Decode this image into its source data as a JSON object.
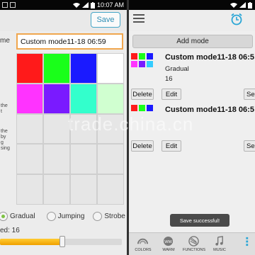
{
  "left_panel": {
    "status_bar": {
      "time": "10:07 AM"
    },
    "save_label": "Save",
    "name_label_fragment": "me",
    "name_value": "Custom mode11-18 06:59",
    "cut_text_1": "the\nt",
    "cut_text_2": "the\nby\ng\nsing",
    "modes": [
      {
        "label": "Gradual",
        "selected": true
      },
      {
        "label": "Jumping",
        "selected": false
      },
      {
        "label": "Strobe",
        "selected": false
      }
    ],
    "speed_label": "ed: 16",
    "speed_value": 16,
    "grid_colors": [
      "#ff1a1a",
      "#1aff1a",
      "#1a1aff",
      "#ffffff",
      "#ff33ff",
      "#7a1aff",
      "#33ffcc",
      "#d0ffd0"
    ]
  },
  "right_panel": {
    "add_mode_label": "Add mode",
    "cards": [
      {
        "title": "Custom mode11-18 06:5",
        "mode": "Gradual",
        "speed": "16",
        "swatches": [
          "#ff1a1a",
          "#1aff1a",
          "#1a1aff",
          "#ff33ff",
          "#7a1aff",
          "#33ccff"
        ],
        "delete_label": "Delete",
        "edit_label": "Edit",
        "set_label": "Se"
      },
      {
        "title": "Custom mode11-18 06:5",
        "mode": "",
        "speed": "",
        "swatches": [
          "#ff1a1a",
          "#1aff1a",
          "#1a1aff"
        ],
        "delete_label": "Delete",
        "edit_label": "Edit",
        "set_label": "Se"
      }
    ],
    "toast": "Save successful!",
    "nav": [
      {
        "label": "COLORS",
        "icon": "rainbow-icon"
      },
      {
        "label": "WARM",
        "icon": "warm-icon"
      },
      {
        "label": "FUNCTIONS",
        "icon": "functions-icon"
      },
      {
        "label": "MUSIC",
        "icon": "music-icon"
      },
      {
        "label": "",
        "icon": "modes-icon"
      }
    ]
  },
  "watermark": "trade.china.cn"
}
